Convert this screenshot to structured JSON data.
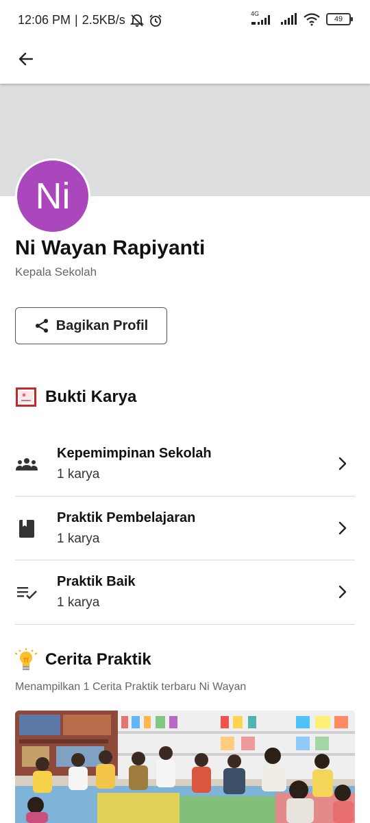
{
  "status_bar": {
    "time": "12:06 PM",
    "separator": "|",
    "speed": "2.5KB/s",
    "network_type": "4G",
    "battery": "49",
    "icons": [
      "mute-notification-icon",
      "alarm-icon",
      "signal-icon",
      "signal-icon",
      "wifi-icon",
      "battery-icon"
    ]
  },
  "app_bar": {
    "back_icon": "arrow-left-icon"
  },
  "profile": {
    "initials": "Ni",
    "name": "Ni Wayan Rapiyanti",
    "role": "Kepala Sekolah",
    "avatar_color": "#ab47bc",
    "share_label": "Bagikan Profil",
    "share_icon": "share-icon"
  },
  "bukti_karya": {
    "title": "Bukti Karya",
    "icon": "certificate-frame-icon",
    "items": [
      {
        "title": "Kepemimpinan Sekolah",
        "subtitle": "1 karya",
        "icon": "group-icon"
      },
      {
        "title": "Praktik Pembelajaran",
        "subtitle": "1 karya",
        "icon": "book-icon"
      },
      {
        "title": "Praktik Baik",
        "subtitle": "1 karya",
        "icon": "checklist-icon"
      }
    ]
  },
  "cerita_praktik": {
    "title": "Cerita Praktik",
    "icon": "lightbulb-icon",
    "subtitle": "Menampilkan 1 Cerita Praktik terbaru Ni Wayan",
    "photo": "classroom-photo"
  }
}
